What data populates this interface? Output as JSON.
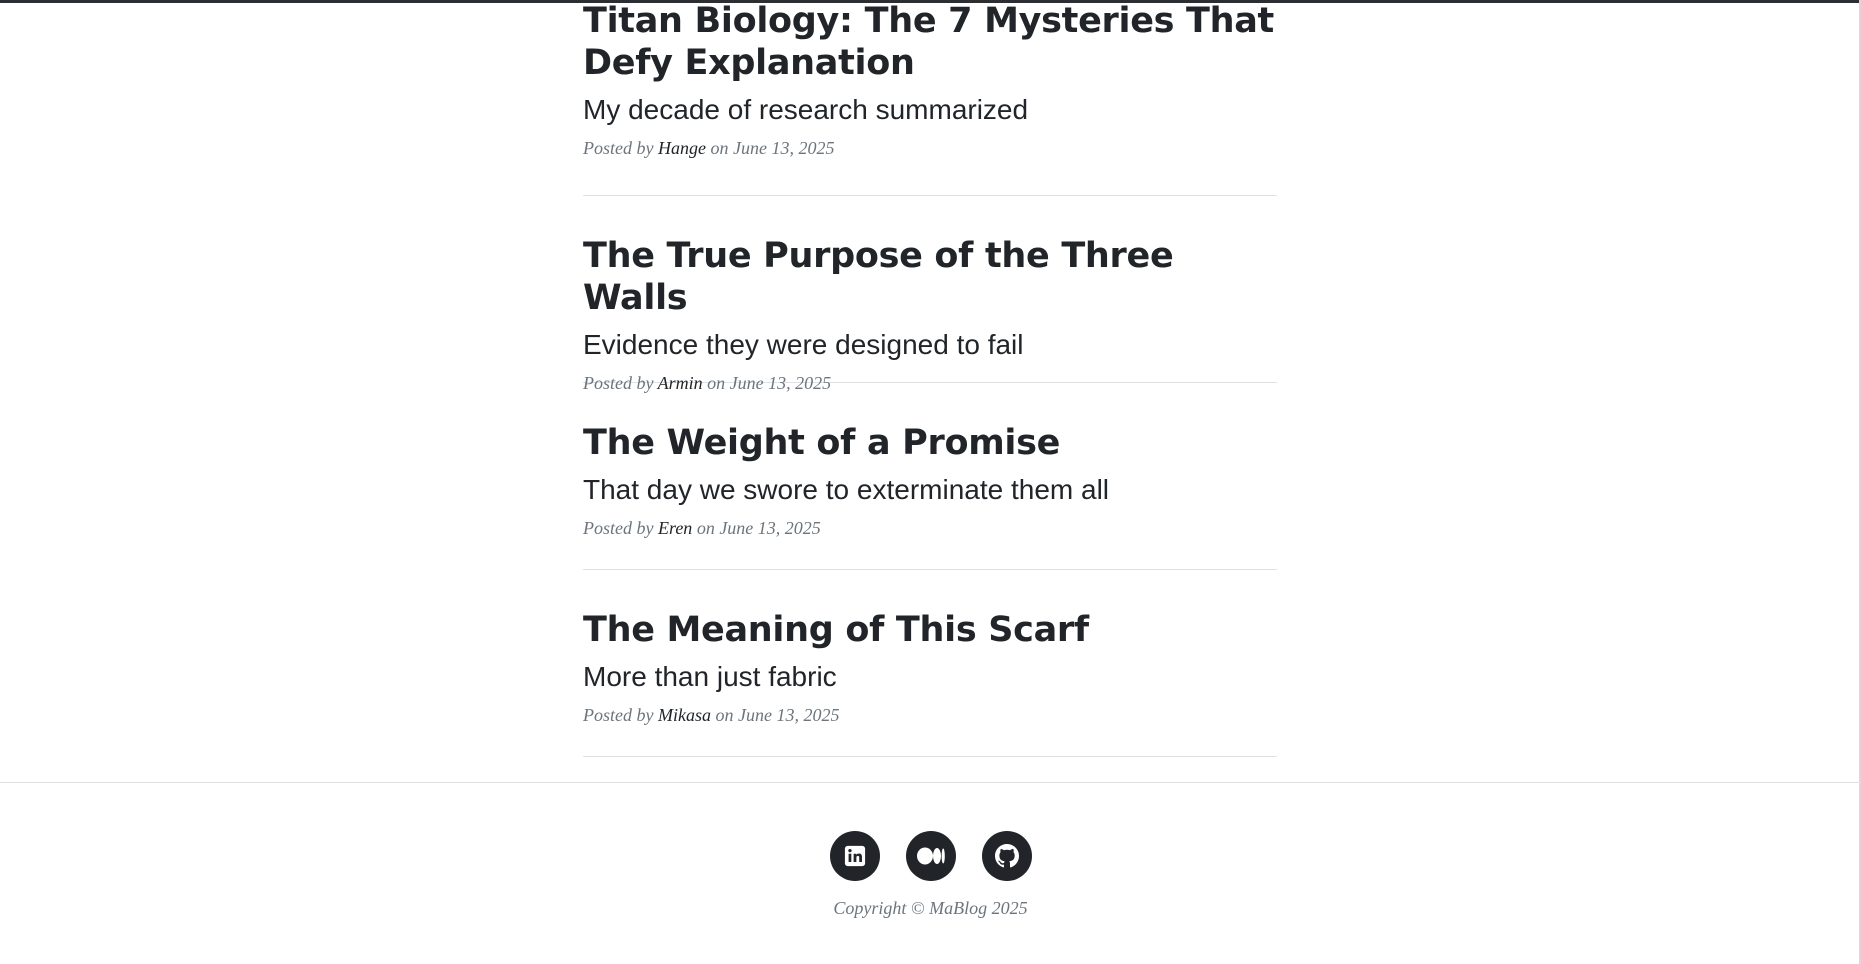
{
  "posts": [
    {
      "title_line1": "Titan Biology: The 7 Mysteries That",
      "title_line2": "Defy Explanation",
      "subtitle": "My decade of research summarized",
      "meta_prefix": "Posted by",
      "author": "Hange",
      "meta_suffix": "on June 13, 2025"
    },
    {
      "title": "The True Purpose of the Three Walls",
      "subtitle": "Evidence they were designed to fail",
      "meta_prefix": "Posted by",
      "author": "Armin",
      "meta_suffix": "on June 13, 2025"
    },
    {
      "title": "The Weight of a Promise",
      "subtitle": "That day we swore to exterminate them all",
      "meta_prefix": "Posted by",
      "author": "Eren",
      "meta_suffix": "on June 13, 2025"
    },
    {
      "title": "The Meaning of This Scarf",
      "subtitle": "More than just fabric",
      "meta_prefix": "Posted by",
      "author": "Mikasa",
      "meta_suffix": "on June 13, 2025"
    }
  ],
  "footer": {
    "socials": [
      {
        "icon": "linkedin-icon"
      },
      {
        "icon": "medium-icon"
      },
      {
        "icon": "github-icon"
      }
    ],
    "copyright": "Copyright © MaBlog 2025"
  },
  "colors": {
    "text": "#212529",
    "muted": "#6c757d",
    "divider": "#dee2e6",
    "icon_bg": "#212529"
  }
}
